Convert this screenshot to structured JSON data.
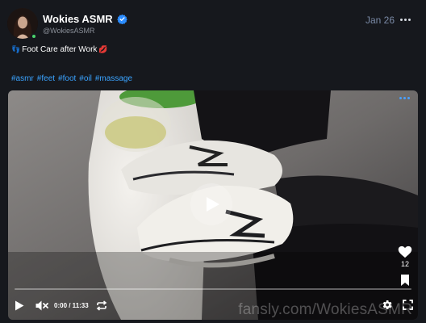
{
  "post": {
    "author_name": "Wokies ASMR",
    "author_handle": "@WokiesASMR",
    "date": "Jan 26",
    "caption_text": "Foot Care after Work",
    "caption_emoji_left": "👣",
    "caption_emoji_right": "💋",
    "hashtags": [
      "#asmr",
      "#feet",
      "#foot",
      "#oil",
      "#massage"
    ]
  },
  "video": {
    "time_display": "0:00 / 11:33",
    "likes_count": "12",
    "watermark": "fansly.com/WokiesASMR",
    "progress_fraction": 0.0
  },
  "colors": {
    "background": "#16181d",
    "accent_blue": "#3aa3ff",
    "online_green": "#4ad36b",
    "date_color": "#7a8aa6"
  },
  "icons": {
    "verified": "verified-badge-icon",
    "more": "more-horizontal-icon",
    "play": "play-icon",
    "mute": "volume-muted-icon",
    "loop": "loop-icon",
    "settings": "gear-icon",
    "fullscreen": "fullscreen-icon",
    "like": "heart-icon",
    "bookmark": "bookmark-icon"
  }
}
